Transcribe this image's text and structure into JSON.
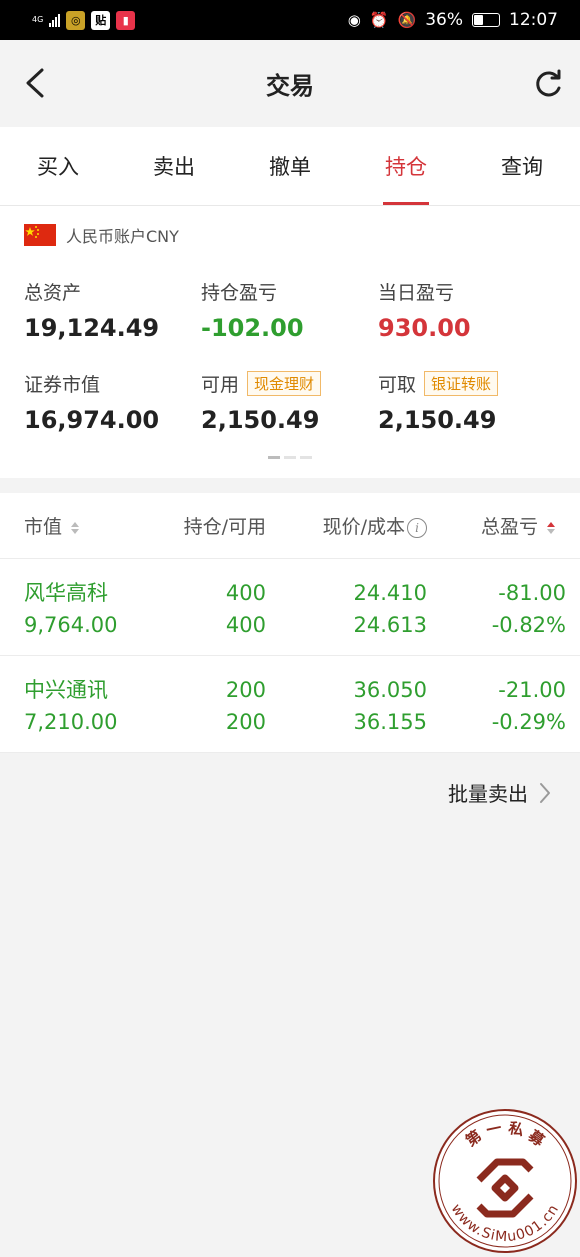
{
  "status_bar": {
    "network": "4G",
    "app_icon_2": "贴",
    "battery": "36%",
    "battery_level": 0.36,
    "time": "12:07"
  },
  "nav": {
    "title": "交易"
  },
  "tabs": [
    {
      "label": "买入"
    },
    {
      "label": "卖出"
    },
    {
      "label": "撤单"
    },
    {
      "label": "持仓",
      "active": true
    },
    {
      "label": "查询"
    }
  ],
  "account": {
    "name": "人民币账户CNY",
    "total_assets_label": "总资产",
    "total_assets": "19,124.49",
    "position_pnl_label": "持仓盈亏",
    "position_pnl": "-102.00",
    "daily_pnl_label": "当日盈亏",
    "daily_pnl": "930.00",
    "market_value_label": "证券市值",
    "market_value": "16,974.00",
    "available_label": "可用",
    "available_chip": "现金理财",
    "available": "2,150.49",
    "withdrawable_label": "可取",
    "withdrawable_chip": "银证转账",
    "withdrawable": "2,150.49"
  },
  "table": {
    "headers": [
      "市值",
      "持仓/可用",
      "现价/成本",
      "总盈亏"
    ],
    "rows": [
      {
        "name": "风华高科",
        "market_value": "9,764.00",
        "position": "400",
        "available": "400",
        "price": "24.410",
        "cost": "24.613",
        "pnl": "-81.00",
        "pnl_pct": "-0.82%"
      },
      {
        "name": "中兴通讯",
        "market_value": "7,210.00",
        "position": "200",
        "available": "200",
        "price": "36.050",
        "cost": "36.155",
        "pnl": "-21.00",
        "pnl_pct": "-0.29%"
      }
    ]
  },
  "batch_sell": "批量卖出",
  "watermark": {
    "text_top": "第 一 私 募",
    "text_bottom": "www.SiMu001.cn"
  },
  "colors": {
    "accent": "#d4353a",
    "gain": "#d4353a",
    "loss": "#2f9e2f",
    "chip": "#e08a00"
  }
}
